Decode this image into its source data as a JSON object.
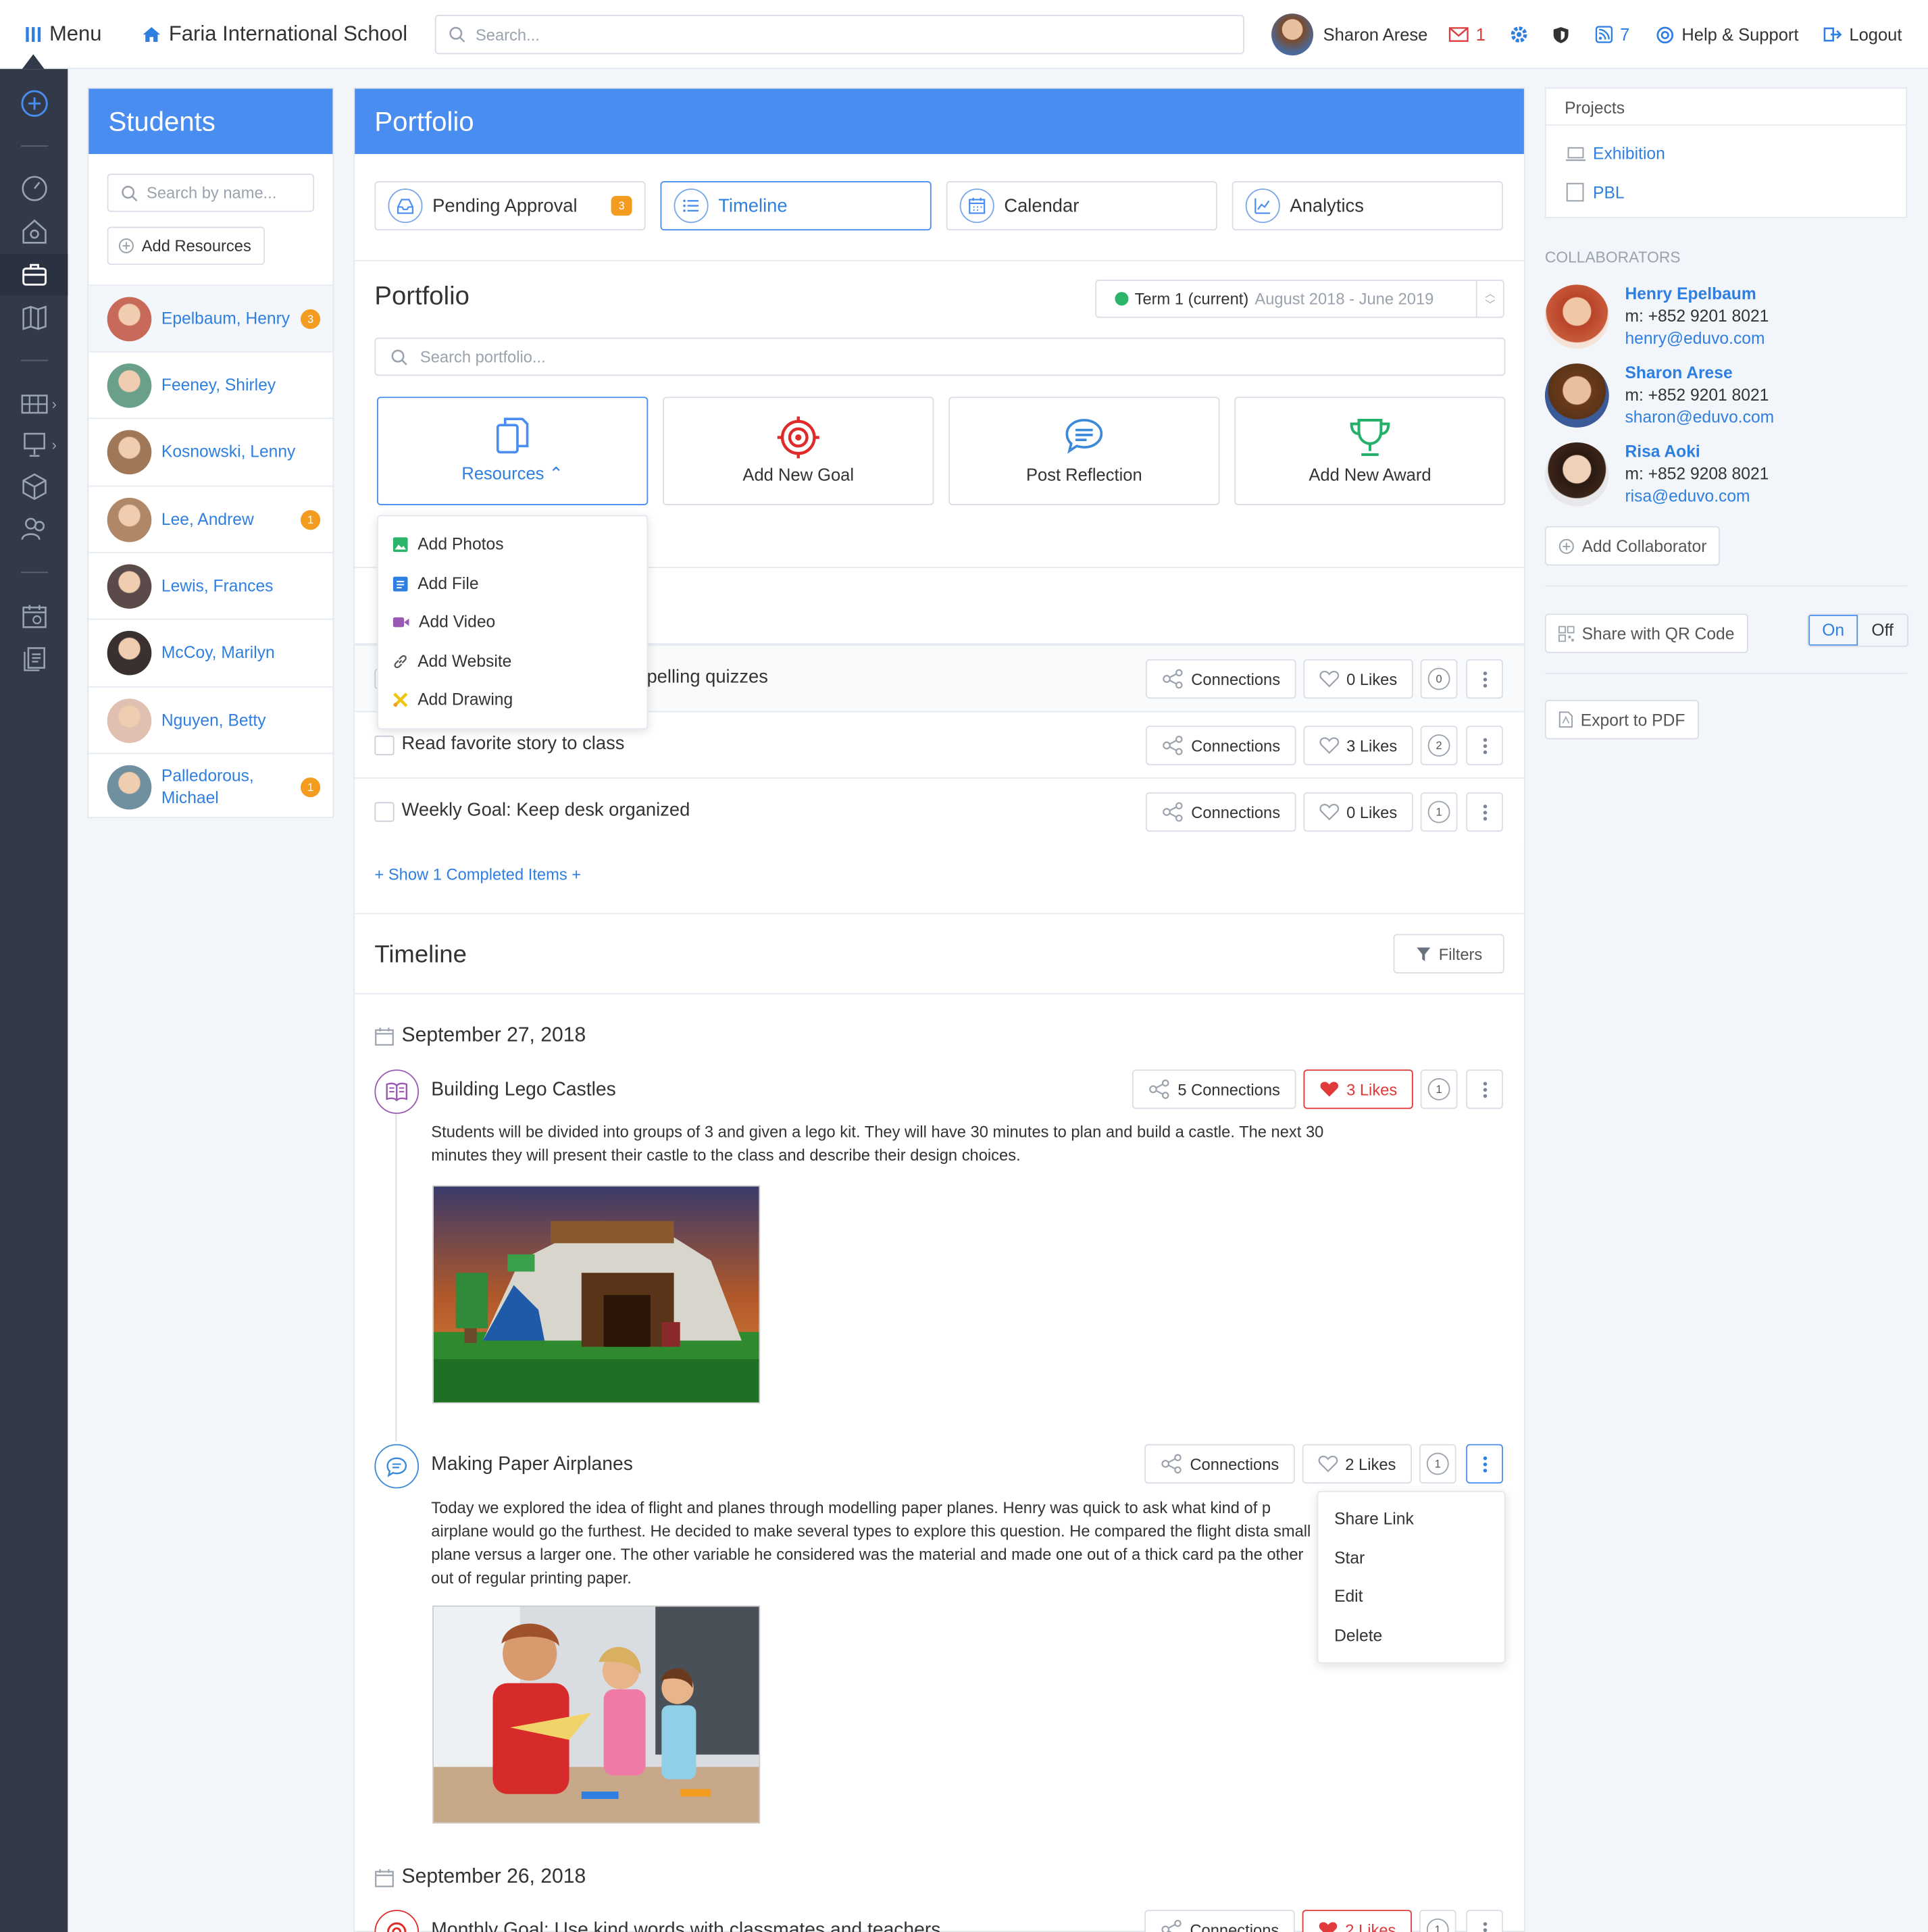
{
  "topbar": {
    "menu_label": "Menu",
    "school_name": "Faria International School",
    "search_placeholder": "Search...",
    "user_name": "Sharon Arese",
    "mail_count": "1",
    "feed_count": "7",
    "help_label": "Help & Support",
    "logout_label": "Logout"
  },
  "students": {
    "title": "Students",
    "search_placeholder": "Search by name...",
    "add_resources_label": "Add Resources",
    "items": [
      {
        "name": "Epelbaum, Henry",
        "badge": "3",
        "color": "#c86a5a"
      },
      {
        "name": "Feeney, Shirley",
        "badge": "",
        "color": "#6aa08a"
      },
      {
        "name": "Kosnowski, Lenny",
        "badge": "",
        "color": "#a07858"
      },
      {
        "name": "Lee, Andrew",
        "badge": "1",
        "color": "#b08868"
      },
      {
        "name": "Lewis, Frances",
        "badge": "",
        "color": "#5a4a4a"
      },
      {
        "name": "McCoy, Marilyn",
        "badge": "",
        "color": "#3a3030"
      },
      {
        "name": "Nguyen, Betty",
        "badge": "",
        "color": "#e0c0b0"
      },
      {
        "name": "Palledorous, Michael",
        "badge": "1",
        "color": "#7090a0"
      }
    ]
  },
  "portfolio": {
    "header": "Portfolio",
    "tabs": [
      {
        "label": "Pending Approval",
        "badge": "3"
      },
      {
        "label": "Timeline",
        "badge": ""
      },
      {
        "label": "Calendar",
        "badge": ""
      },
      {
        "label": "Analytics",
        "badge": ""
      }
    ],
    "section_title": "Portfolio",
    "term_label": "Term 1 (current)",
    "term_range": "August 2018 - June 2019",
    "search_placeholder": "Search portfolio...",
    "actions": {
      "resources": "Resources",
      "goal": "Add New Goal",
      "reflection": "Post Reflection",
      "award": "Add New Award"
    },
    "resources_menu": [
      "Add Photos",
      "Add File",
      "Add Video",
      "Add Website",
      "Add Drawing"
    ],
    "goals": [
      {
        "text": "pelling quizzes",
        "connections": "Connections",
        "likes": "0 Likes",
        "comments": "0"
      },
      {
        "text": "Read favorite story to class",
        "connections": "Connections",
        "likes": "3 Likes",
        "comments": "2"
      },
      {
        "text": "Weekly Goal: Keep desk organized",
        "connections": "Connections",
        "likes": "0 Likes",
        "comments": "1"
      }
    ],
    "show_completed": "+ Show 1 Completed Items +"
  },
  "timeline": {
    "title": "Timeline",
    "filters_label": "Filters",
    "date1": "September 27, 2018",
    "post1": {
      "title": "Building Lego Castles",
      "connections": "5 Connections",
      "likes": "3 Likes",
      "comments": "1",
      "body": "Students will be divided into groups of 3 and given a lego kit. They will have 30 minutes to plan and build a castle. The next 30 minutes they will present their castle to the class and describe their design choices."
    },
    "post2": {
      "title": "Making Paper Airplanes",
      "connections": "Connections",
      "likes": "2 Likes",
      "comments": "1",
      "body": "Today we explored the idea of flight and planes through modelling paper planes. Henry was quick to ask what kind of p airplane would go the furthest. He decided to make several types to explore this question. He compared the flight dista small plane versus a larger one. The other variable he considered was the material and made one out of a thick card pa the other out of regular printing paper."
    },
    "post_menu": [
      "Share Link",
      "Star",
      "Edit",
      "Delete"
    ],
    "date2": "September 26, 2018",
    "post3": {
      "title": "Monthly Goal: Use kind words with classmates and teachers",
      "connections": "Connections",
      "likes": "2 Likes",
      "comments": "1"
    }
  },
  "right": {
    "projects_title": "Projects",
    "projects": [
      "Exhibition",
      "PBL"
    ],
    "collaborators_title": "COLLABORATORS",
    "collaborators": [
      {
        "name": "Henry Epelbaum",
        "phone": "m: +852 9201 8021",
        "email": "henry@eduvo.com"
      },
      {
        "name": "Sharon Arese",
        "phone": "m: +852 9201 8021",
        "email": "sharon@eduvo.com"
      },
      {
        "name": "Risa Aoki",
        "phone": "m: +852 9208 8021",
        "email": "risa@eduvo.com"
      }
    ],
    "add_collaborator": "Add Collaborator",
    "share_qr": "Share with QR Code",
    "toggle_on": "On",
    "toggle_off": "Off",
    "export_pdf": "Export to PDF"
  },
  "colors": {
    "accent": "#4a8df0",
    "link": "#2f7fe0",
    "rail": "#323a4a",
    "badge": "#f39c20",
    "like_active": "#e03a3a"
  }
}
